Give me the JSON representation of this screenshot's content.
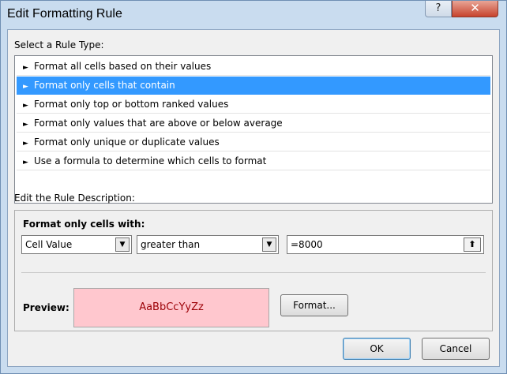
{
  "window": {
    "title": "Edit Formatting Rule",
    "help_label": "?",
    "close_label": "✕"
  },
  "rule_type": {
    "label": "Select a Rule Type:",
    "items": [
      {
        "label": "Format all cells based on their values"
      },
      {
        "label": "Format only cells that contain"
      },
      {
        "label": "Format only top or bottom ranked values"
      },
      {
        "label": "Format only values that are above or below average"
      },
      {
        "label": "Format only unique or duplicate values"
      },
      {
        "label": "Use a formula to determine which cells to format"
      }
    ],
    "selected_index": 1,
    "bullet": "►"
  },
  "description": {
    "label": "Edit the Rule Description:",
    "heading": "Format only cells with:",
    "condition_type": "Cell Value",
    "operator": "greater than",
    "value": "=8000",
    "dropdown_glyph": "▼",
    "collapse_glyph": "⬆",
    "preview_label": "Preview:",
    "preview_text": "AaBbCcYyZz",
    "format_button": "Format..."
  },
  "buttons": {
    "ok": "OK",
    "cancel": "Cancel"
  },
  "colors": {
    "selection": "#3399ff",
    "preview_fill": "#ffc7ce",
    "preview_text": "#9c0006",
    "title_bar": "#c9dcef",
    "close_button": "#c7432d"
  }
}
